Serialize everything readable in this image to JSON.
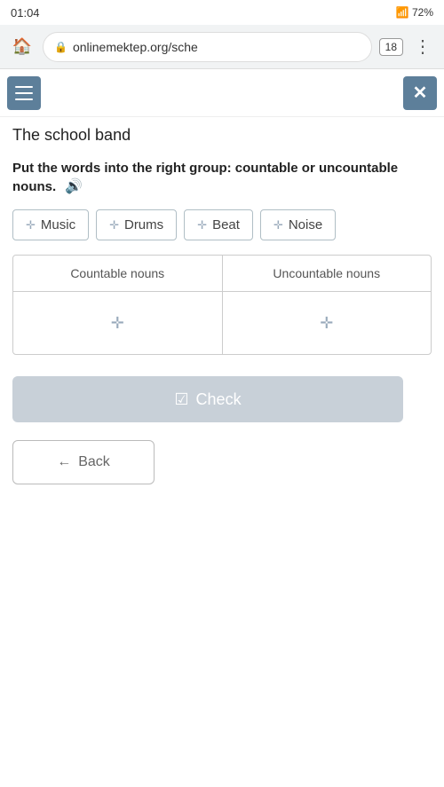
{
  "statusBar": {
    "time": "01:04",
    "tabCount": "18"
  },
  "browserBar": {
    "addressText": "onlinemektep.org/sche",
    "lockIcon": "🔒"
  },
  "topNav": {
    "menuIcon": "☰",
    "closeIcon": "✕"
  },
  "pageTitle": "The school band",
  "instruction": "Put the words into the right group: countable or uncountable nouns.",
  "soundIcon": "🔊",
  "wordChips": [
    {
      "label": "Music",
      "dragIcon": "✛"
    },
    {
      "label": "Drums",
      "dragIcon": "✛"
    },
    {
      "label": "Beat",
      "dragIcon": "✛"
    },
    {
      "label": "Noise",
      "dragIcon": "✛"
    }
  ],
  "dropZones": {
    "col1": {
      "header": "Countable nouns",
      "icon": "✛"
    },
    "col2": {
      "header": "Uncountable nouns",
      "icon": "✛"
    }
  },
  "checkButton": {
    "icon": "☑",
    "label": "Check"
  },
  "backButton": {
    "icon": "←",
    "label": "Back"
  }
}
